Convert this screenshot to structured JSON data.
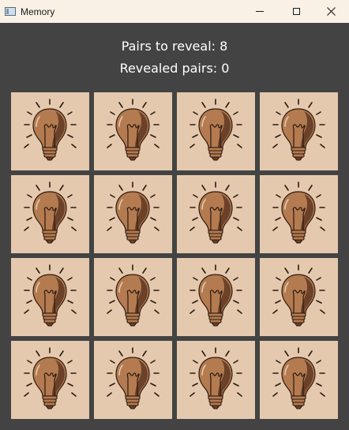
{
  "window": {
    "title": "Memory"
  },
  "status": {
    "pairs_to_reveal": "Pairs to reveal: 8",
    "revealed_pairs": "Revealed pairs: 0"
  },
  "cards": [
    {
      "state": "face-down",
      "icon": "lightbulb-icon"
    },
    {
      "state": "face-down",
      "icon": "lightbulb-icon"
    },
    {
      "state": "face-down",
      "icon": "lightbulb-icon"
    },
    {
      "state": "face-down",
      "icon": "lightbulb-icon"
    },
    {
      "state": "face-down",
      "icon": "lightbulb-icon"
    },
    {
      "state": "face-down",
      "icon": "lightbulb-icon"
    },
    {
      "state": "face-down",
      "icon": "lightbulb-icon"
    },
    {
      "state": "face-down",
      "icon": "lightbulb-icon"
    },
    {
      "state": "face-down",
      "icon": "lightbulb-icon"
    },
    {
      "state": "face-down",
      "icon": "lightbulb-icon"
    },
    {
      "state": "face-down",
      "icon": "lightbulb-icon"
    },
    {
      "state": "face-down",
      "icon": "lightbulb-icon"
    },
    {
      "state": "face-down",
      "icon": "lightbulb-icon"
    },
    {
      "state": "face-down",
      "icon": "lightbulb-icon"
    },
    {
      "state": "face-down",
      "icon": "lightbulb-icon"
    },
    {
      "state": "face-down",
      "icon": "lightbulb-icon"
    }
  ],
  "colors": {
    "background": "#434343",
    "card": "#e5c9ae",
    "bulb": "#b47b50",
    "bulb_shadow": "#6b4129",
    "outline": "#2b1a10"
  }
}
